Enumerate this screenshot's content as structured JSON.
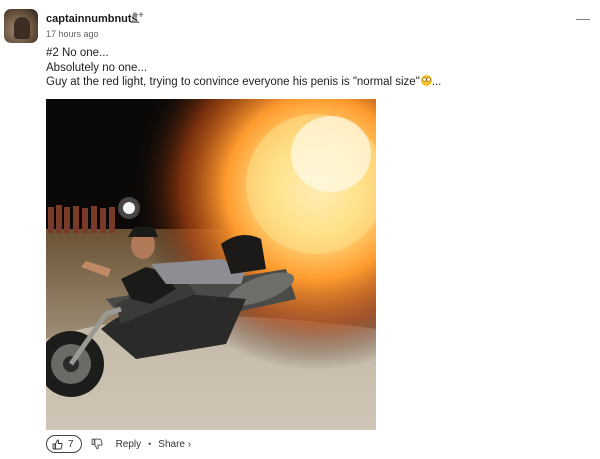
{
  "comment": {
    "username": "captainnumbnuts",
    "timestamp": "17 hours ago",
    "lines": [
      "#2 No one...",
      "Absolutely no one...",
      "Guy at the red light, trying to convince everyone his penis is \"normal size\""
    ],
    "line3_suffix": "...",
    "emoji": "flushed-face-emoji",
    "image_description_icon": "photo"
  },
  "actions": {
    "like_count": "7",
    "reply_label": "Reply",
    "separator": "•",
    "share_label": "Share ›"
  },
  "icons": {
    "follow": "add-user-icon",
    "collapse": "minus-icon",
    "like": "thumbs-up-icon",
    "dislike": "thumbs-down-icon"
  },
  "header": {
    "collapse_glyph": "—"
  }
}
